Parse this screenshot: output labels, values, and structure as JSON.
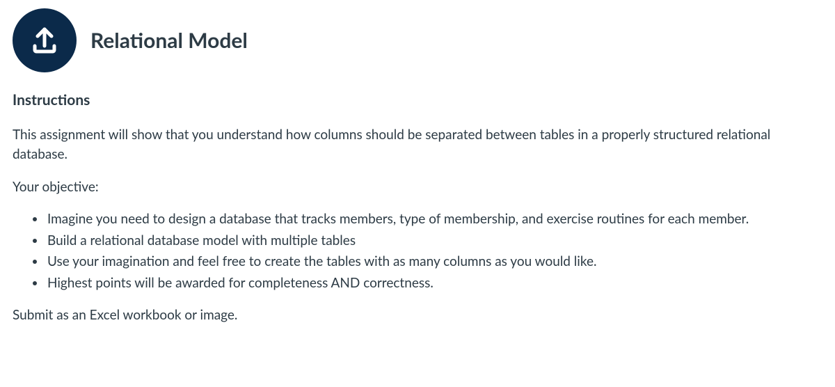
{
  "title": "Relational Model",
  "instructions_heading": "Instructions",
  "intro_paragraph": "This assignment will show that you understand how columns should be separated between tables in a properly structured relational database.",
  "objective_lead": "Your objective:",
  "bullets": [
    "Imagine you need to design a database that tracks members, type of membership, and exercise routines for each member.",
    "Build a relational database model with multiple tables",
    "Use your imagination and feel free to create the tables with as many columns as you would like.",
    "Highest points will be awarded for completeness AND correctness."
  ],
  "submit_line": "Submit as an Excel workbook or image."
}
